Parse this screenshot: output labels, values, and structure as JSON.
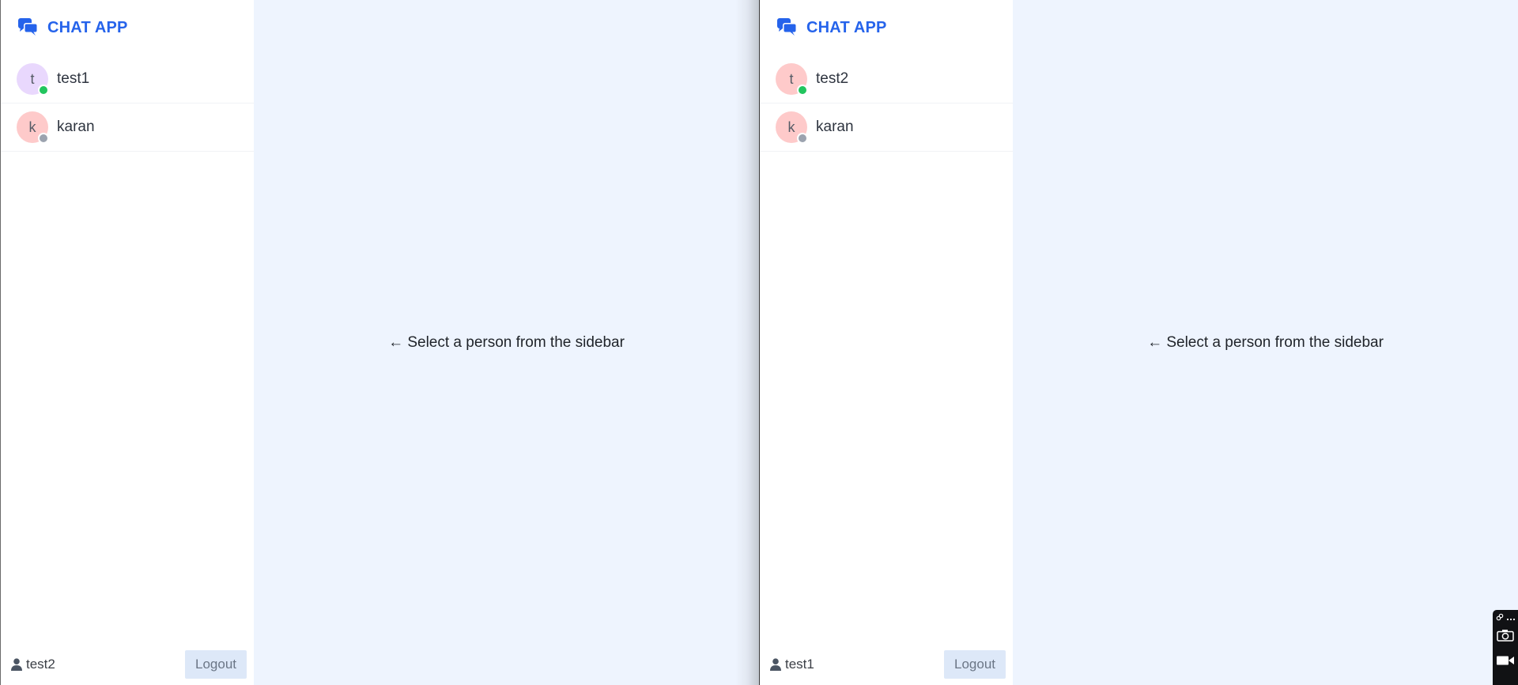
{
  "windows": [
    {
      "brand": {
        "title": "CHAT APP",
        "icon": "chat-bubbles-icon"
      },
      "contacts": [
        {
          "initial": "t",
          "name": "test1",
          "avatar_color": "#e9d8fd",
          "status": "online",
          "status_color": "#22c55e"
        },
        {
          "initial": "k",
          "name": "karan",
          "avatar_color": "#fecaca",
          "status": "offline",
          "status_color": "#9ca3af"
        }
      ],
      "footer": {
        "current_user": "test2",
        "logout_label": "Logout"
      },
      "main": {
        "placeholder": "← Select a person from the sidebar"
      }
    },
    {
      "brand": {
        "title": "CHAT APP",
        "icon": "chat-bubbles-icon"
      },
      "contacts": [
        {
          "initial": "t",
          "name": "test2",
          "avatar_color": "#fecaca",
          "status": "online",
          "status_color": "#22c55e"
        },
        {
          "initial": "k",
          "name": "karan",
          "avatar_color": "#fecaca",
          "status": "offline",
          "status_color": "#9ca3af"
        }
      ],
      "footer": {
        "current_user": "test1",
        "logout_label": "Logout"
      },
      "main": {
        "placeholder": "← Select a person from the sidebar"
      }
    }
  ],
  "colors": {
    "accent": "#2563eb",
    "main_bg": "#eef4fe",
    "logout_bg": "#dde8f8"
  },
  "floating_toolbar": {
    "icons": [
      "link-icon",
      "more-icon",
      "camera-icon",
      "video-camera-icon"
    ]
  }
}
